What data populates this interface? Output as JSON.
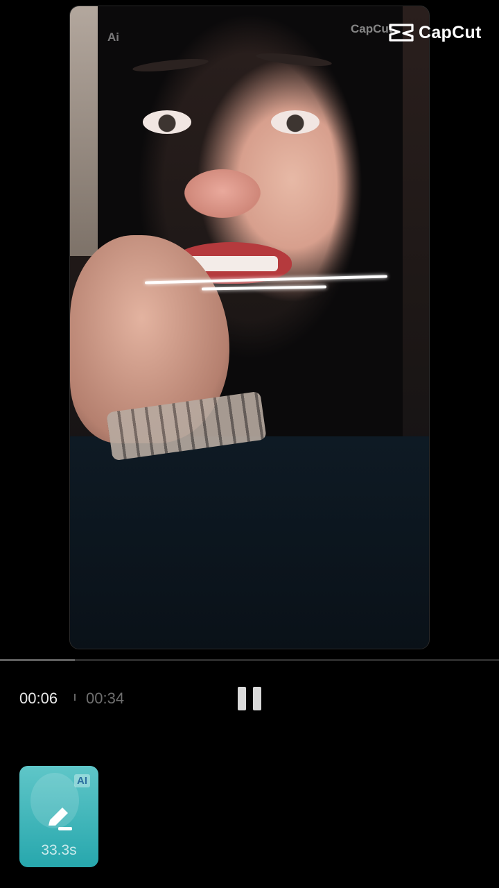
{
  "app": {
    "brand": "CapCut"
  },
  "preview": {
    "ai_tag": "Ai",
    "watermark": "CapCut"
  },
  "playback": {
    "current_time": "00:06",
    "total_time": "00:34",
    "progress_fraction": 0.15,
    "state": "playing"
  },
  "clip": {
    "ai_badge": "AI",
    "duration": "33.3s"
  },
  "icons": {
    "brand": "capcut-logo-icon",
    "control": "pause-icon",
    "clip_edit": "pencil-icon"
  },
  "colors": {
    "background": "#000000",
    "clip_accent": "#3bb6bb"
  }
}
